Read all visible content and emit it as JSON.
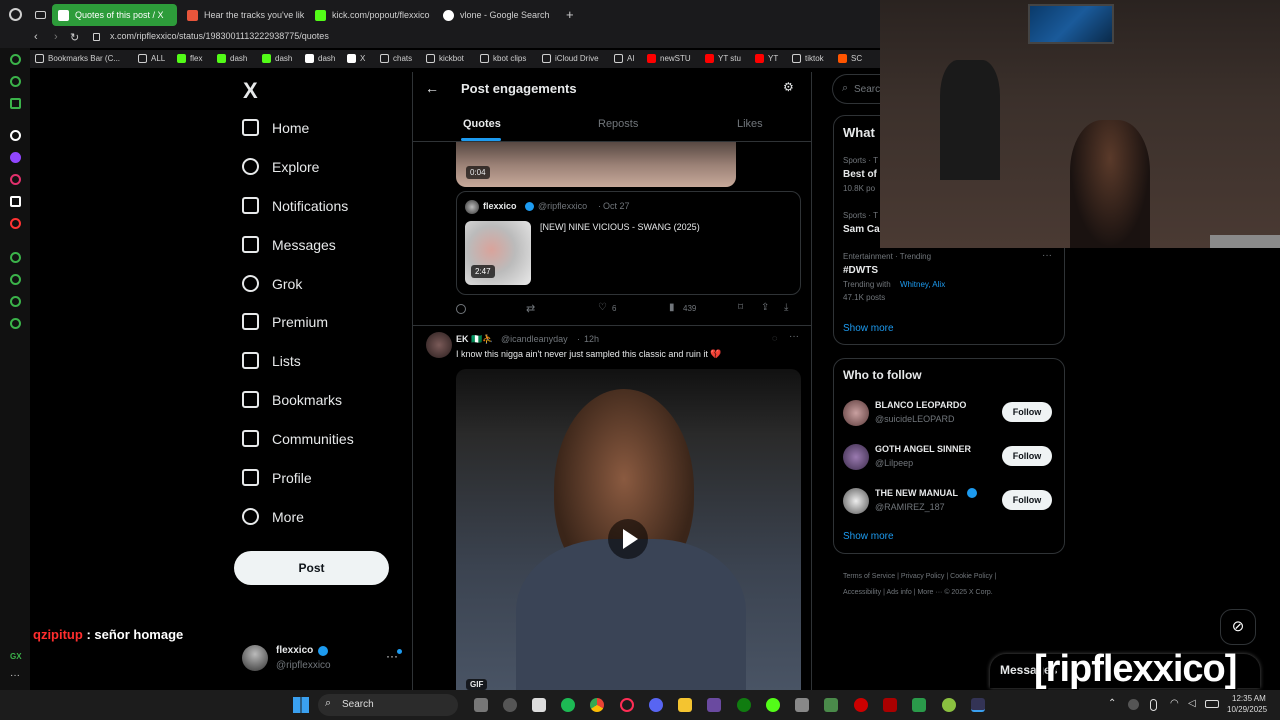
{
  "browser": {
    "tabs": [
      {
        "label": "Quotes of this post / X",
        "color": "#2d9c3a",
        "active": true
      },
      {
        "label": "Hear the tracks you've lik",
        "color": "#e8553b",
        "active": false
      },
      {
        "label": "kick.com/popout/flexxico",
        "color": "#53fc18",
        "active": false
      },
      {
        "label": "vlone - Google Search",
        "color": "#ffffff",
        "active": false
      }
    ],
    "new_tab_label": "+",
    "url": "x.com/ripflexxico/status/1983001113222938775/quotes",
    "bookmarks": [
      {
        "label": "Bookmarks Bar (C...",
        "color": "#cfcfcf"
      },
      {
        "label": "ALL",
        "color": "#cfcfcf"
      },
      {
        "label": "flex",
        "color": "#53fc18"
      },
      {
        "label": "dash",
        "color": "#53fc18"
      },
      {
        "label": "dash",
        "color": "#53fc18"
      },
      {
        "label": "dash",
        "color": "#ffffff"
      },
      {
        "label": "X",
        "color": "#ffffff"
      },
      {
        "label": "chats",
        "color": "#cfcfcf"
      },
      {
        "label": "kickbot",
        "color": "#cfcfcf"
      },
      {
        "label": "kbot clips",
        "color": "#cfcfcf"
      },
      {
        "label": "iCloud Drive",
        "color": "#cfcfcf"
      },
      {
        "label": "AI",
        "color": "#cfcfcf"
      },
      {
        "label": "newSTU",
        "color": "#ff0000"
      },
      {
        "label": "YT stu",
        "color": "#ff0000"
      },
      {
        "label": "YT",
        "color": "#ff0000"
      },
      {
        "label": "tiktok",
        "color": "#cfcfcf"
      },
      {
        "label": "SC",
        "color": "#ff5500"
      }
    ]
  },
  "nav": {
    "logo": "X",
    "items": [
      {
        "label": "Home",
        "icon": "home-icon"
      },
      {
        "label": "Explore",
        "icon": "search-icon"
      },
      {
        "label": "Notifications",
        "icon": "bell-icon"
      },
      {
        "label": "Messages",
        "icon": "mail-icon"
      },
      {
        "label": "Grok",
        "icon": "grok-icon"
      },
      {
        "label": "Premium",
        "icon": "x-icon"
      },
      {
        "label": "Lists",
        "icon": "list-icon"
      },
      {
        "label": "Bookmarks",
        "icon": "bookmark-icon"
      },
      {
        "label": "Communities",
        "icon": "people-icon"
      },
      {
        "label": "Profile",
        "icon": "person-icon"
      },
      {
        "label": "More",
        "icon": "more-circle-icon"
      }
    ],
    "post_label": "Post",
    "account": {
      "name": "flexxico",
      "handle": "@ripflexxico"
    }
  },
  "header": {
    "title": "Post engagements",
    "tabs": [
      "Quotes",
      "Reposts",
      "Likes"
    ]
  },
  "post1": {
    "video_time": "0:04",
    "quoted": {
      "name": "flexxico",
      "handle": "@ripflexxico",
      "date": "Oct 27",
      "text": "[NEW] NINE VICIOUS - SWANG (2025)",
      "duration": "2:47"
    },
    "actions": {
      "likes": "6",
      "views": "439"
    }
  },
  "post2": {
    "name": "EK 🇳🇬⛹️",
    "handle": "@icandleanyday",
    "time": "12h",
    "text": "I know this nigga ain't never just sampled this classic and ruin it 💔",
    "media_label": "GIF"
  },
  "right": {
    "search_placeholder": "Searc",
    "trending_title": "What",
    "trends": [
      {
        "meta": "Sports · T",
        "title": "Best of",
        "sub": "10.8K po"
      },
      {
        "meta": "Sports · T",
        "title": "Sam Ca",
        "sub": ""
      },
      {
        "meta": "Entertainment · Trending",
        "title": "#DWTS",
        "sub_prefix": "Trending with",
        "sub_links": "Whitney, Alix",
        "sub": "47.1K posts"
      }
    ],
    "show_more": "Show more",
    "who_title": "Who to follow",
    "follows": [
      {
        "name": "BLANCO LEOPARDO",
        "handle": "@suicideLEOPARD",
        "verified": false
      },
      {
        "name": "GOTH ANGEL SINNER",
        "handle": "@Lilpeep",
        "verified": false
      },
      {
        "name": "THE NEW MANUAL",
        "handle": "@RAMIREZ_187",
        "verified": true
      }
    ],
    "follow_label": "Follow",
    "footer": [
      "Terms of Service",
      "Privacy Policy",
      "Cookie Policy",
      "Accessibility",
      "Ads info",
      "More ···",
      "© 2025 X Corp."
    ]
  },
  "overlay": {
    "chat_user": "qzipitup",
    "chat_msg": " : señor homage",
    "watermark": "[ripflexxico]",
    "messages_label": "Messages"
  },
  "taskbar": {
    "search_label": "Search",
    "time": "12:35 AM",
    "date": "10/29/2025"
  }
}
